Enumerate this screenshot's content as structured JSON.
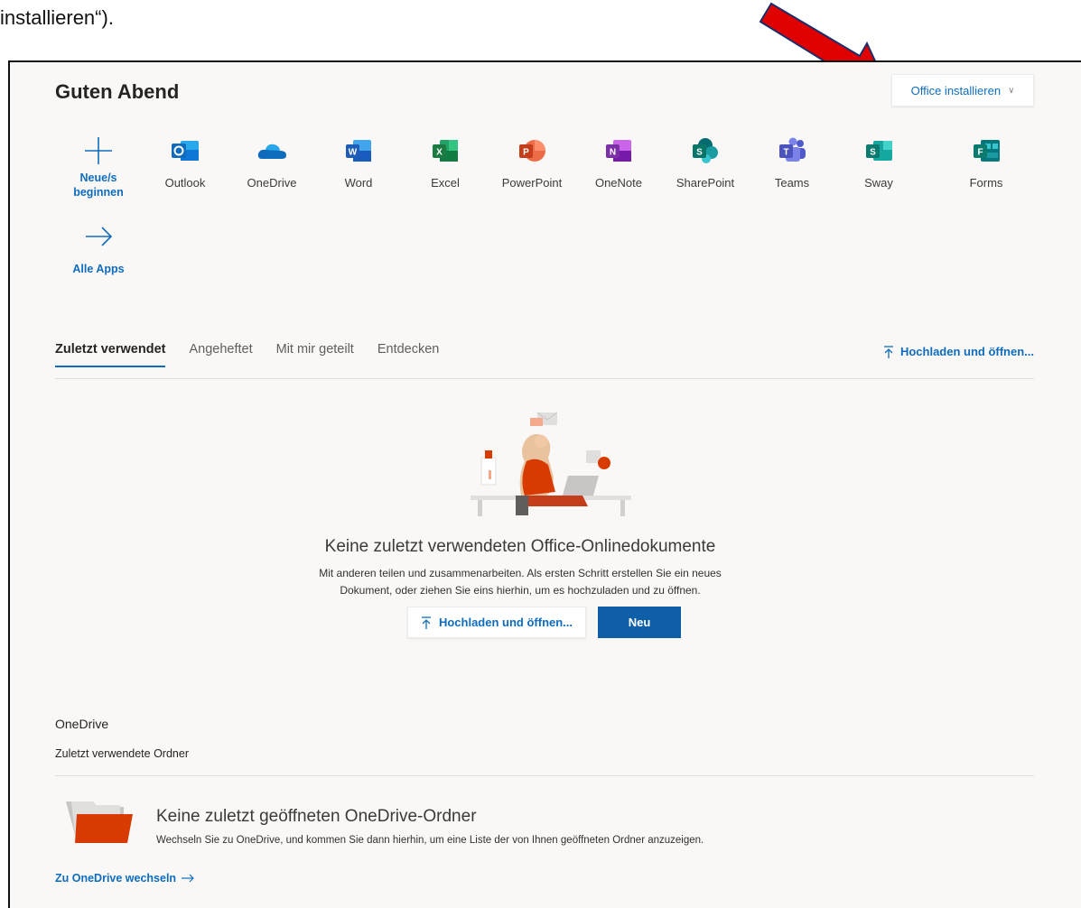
{
  "doc_text": "installieren“).",
  "greeting": "Guten Abend",
  "install_button": {
    "label": "Office installieren",
    "chevron": "∨"
  },
  "apps": [
    {
      "name": "Neue/s beginnen",
      "line1": "Neue/s",
      "line2": "beginnen",
      "icon": "plus-icon"
    },
    {
      "name": "Outlook",
      "icon": "outlook-icon",
      "color": "#0f6cbd"
    },
    {
      "name": "OneDrive",
      "icon": "onedrive-icon",
      "color": "#0f6cbd"
    },
    {
      "name": "Word",
      "icon": "word-icon",
      "color": "#1e5db7"
    },
    {
      "name": "Excel",
      "icon": "excel-icon",
      "color": "#1c7a43"
    },
    {
      "name": "PowerPoint",
      "icon": "powerpoint-icon",
      "color": "#d24726"
    },
    {
      "name": "OneNote",
      "icon": "onenote-icon",
      "color": "#7b2fa6"
    },
    {
      "name": "SharePoint",
      "icon": "sharepoint-icon",
      "color": "#077568"
    },
    {
      "name": "Teams",
      "icon": "teams-icon",
      "color": "#5058b8"
    },
    {
      "name": "Sway",
      "icon": "sway-icon",
      "color": "#0b7a6f"
    },
    {
      "name": "Forms",
      "icon": "forms-icon",
      "color": "#0b7a6f"
    }
  ],
  "all_apps": {
    "label": "Alle Apps",
    "icon": "arrow-right-icon"
  },
  "tabs": [
    {
      "label": "Zuletzt verwendet",
      "active": true
    },
    {
      "label": "Angeheftet",
      "active": false
    },
    {
      "label": "Mit mir geteilt",
      "active": false
    },
    {
      "label": "Entdecken",
      "active": false
    }
  ],
  "upload_link": {
    "label": "Hochladen und öffnen...",
    "icon": "upload-icon"
  },
  "empty_state": {
    "title": "Keine zuletzt verwendeten Office-Onlinedokumente",
    "desc_line1": "Mit anderen teilen und zusammenarbeiten. Als ersten Schritt erstellen Sie ein neues",
    "desc_line2": "Dokument, oder ziehen Sie eins hierhin, um es hochzuladen und zu öffnen.",
    "upload_button": "Hochladen und öffnen...",
    "new_button": "Neu"
  },
  "onedrive": {
    "title": "OneDrive",
    "subtitle": "Zuletzt verwendete Ordner",
    "empty_title": "Keine zuletzt geöffneten OneDrive-Ordner",
    "empty_desc": "Wechseln Sie zu OneDrive, und kommen Sie dann hierhin, um eine Liste der von Ihnen geöffneten Ordner anzuzeigen.",
    "link": "Zu OneDrive wechseln"
  },
  "colors": {
    "accent": "#0f6cbd",
    "primary_button": "#0f5fa8",
    "annotation_arrow": "#e00000"
  }
}
